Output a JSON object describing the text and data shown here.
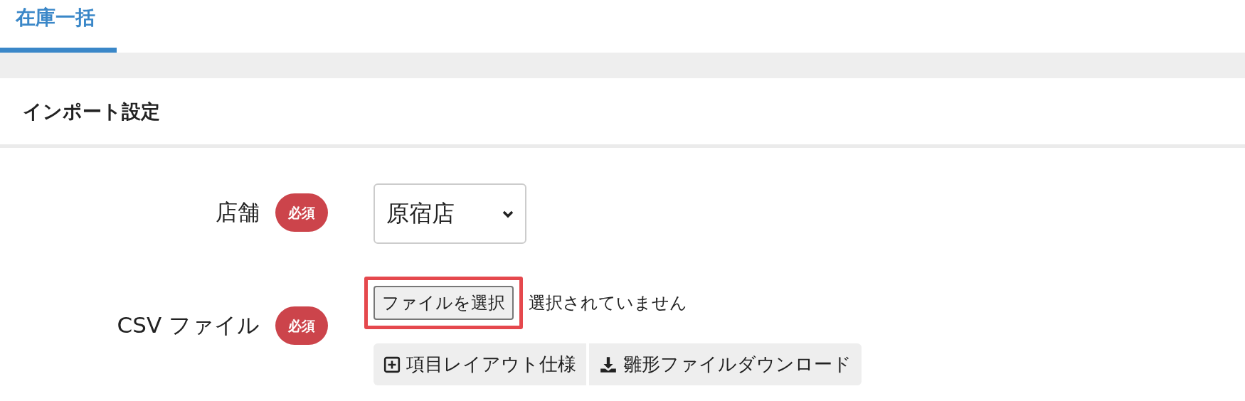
{
  "tabs": [
    {
      "label": "在庫一括",
      "selected": true
    }
  ],
  "section": {
    "title": "インポート設定"
  },
  "fields": [
    {
      "kind": "select",
      "label": "店舗",
      "required_badge": "必須",
      "value": "原宿店"
    },
    {
      "kind": "file",
      "label": "CSV ファイル",
      "required_badge": "必須",
      "button": "ファイルを選択",
      "status": "選択されていません",
      "highlighted": true,
      "actions": [
        {
          "kind": "spec",
          "label": "項目レイアウト仕様"
        },
        {
          "kind": "download",
          "label": "雛形ファイルダウンロード"
        }
      ]
    }
  ]
}
